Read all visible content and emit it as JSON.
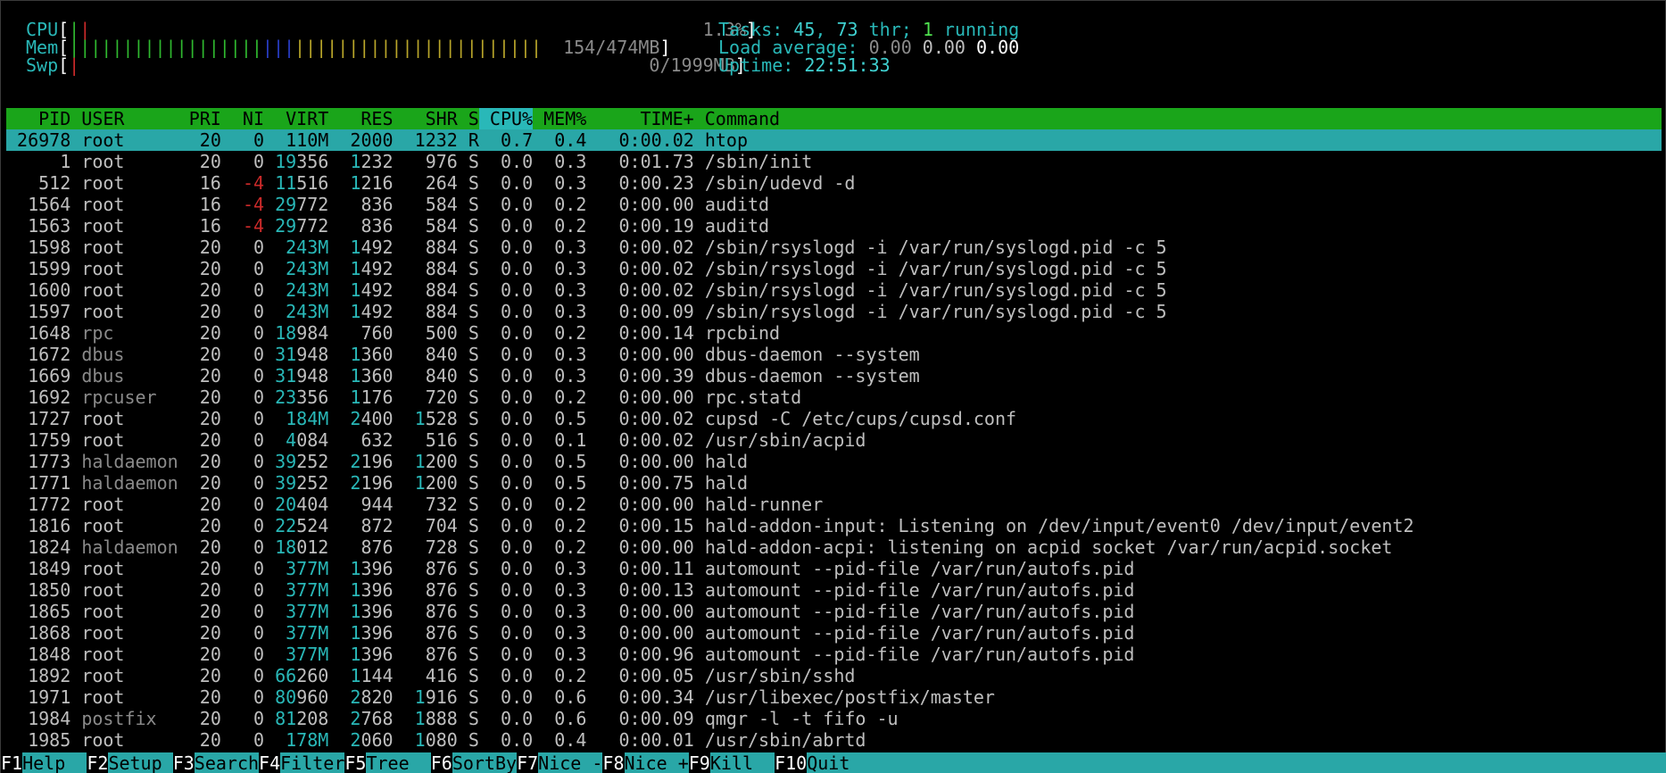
{
  "meters": {
    "cpu": {
      "label": "CPU",
      "value": "1.3%"
    },
    "mem": {
      "label": "Mem",
      "value": "154/474MB"
    },
    "swp": {
      "label": "Swp",
      "value": "0/1999MB"
    }
  },
  "stats": {
    "tasks_label": "Tasks: ",
    "tasks_count": "45",
    "thr_count": "73",
    "thr_label": " thr; ",
    "running_count": "1",
    "running_label": " running",
    "load_label": "Load average: ",
    "load1": "0.00",
    "load5": "0.00",
    "load15": "0.00",
    "uptime_label": "Uptime: ",
    "uptime": "22:51:33"
  },
  "columns": [
    "PID",
    "USER",
    "PRI",
    "NI",
    "VIRT",
    "RES",
    "SHR",
    "S",
    "CPU%",
    "MEM%",
    "TIME+",
    "Command"
  ],
  "sorted_column": "CPU%",
  "processes": [
    {
      "pid": "26978",
      "user": "root",
      "pri": "20",
      "ni": "0",
      "virt": "110M",
      "res": "2000",
      "shr": "1232",
      "s": "R",
      "cpu": "0.7",
      "mem": "0.4",
      "time": "0:00.02",
      "cmd": "htop"
    },
    {
      "pid": "1",
      "user": "root",
      "pri": "20",
      "ni": "0",
      "virt": "19356",
      "res": "1232",
      "shr": "976",
      "s": "S",
      "cpu": "0.0",
      "mem": "0.3",
      "time": "0:01.73",
      "cmd": "/sbin/init"
    },
    {
      "pid": "512",
      "user": "root",
      "pri": "16",
      "ni": "-4",
      "virt": "11516",
      "res": "1216",
      "shr": "264",
      "s": "S",
      "cpu": "0.0",
      "mem": "0.3",
      "time": "0:00.23",
      "cmd": "/sbin/udevd -d"
    },
    {
      "pid": "1564",
      "user": "root",
      "pri": "16",
      "ni": "-4",
      "virt": "29772",
      "res": "836",
      "shr": "584",
      "s": "S",
      "cpu": "0.0",
      "mem": "0.2",
      "time": "0:00.00",
      "cmd": "auditd"
    },
    {
      "pid": "1563",
      "user": "root",
      "pri": "16",
      "ni": "-4",
      "virt": "29772",
      "res": "836",
      "shr": "584",
      "s": "S",
      "cpu": "0.0",
      "mem": "0.2",
      "time": "0:00.19",
      "cmd": "auditd"
    },
    {
      "pid": "1598",
      "user": "root",
      "pri": "20",
      "ni": "0",
      "virt": "243M",
      "res": "1492",
      "shr": "884",
      "s": "S",
      "cpu": "0.0",
      "mem": "0.3",
      "time": "0:00.02",
      "cmd": "/sbin/rsyslogd -i /var/run/syslogd.pid -c 5"
    },
    {
      "pid": "1599",
      "user": "root",
      "pri": "20",
      "ni": "0",
      "virt": "243M",
      "res": "1492",
      "shr": "884",
      "s": "S",
      "cpu": "0.0",
      "mem": "0.3",
      "time": "0:00.02",
      "cmd": "/sbin/rsyslogd -i /var/run/syslogd.pid -c 5"
    },
    {
      "pid": "1600",
      "user": "root",
      "pri": "20",
      "ni": "0",
      "virt": "243M",
      "res": "1492",
      "shr": "884",
      "s": "S",
      "cpu": "0.0",
      "mem": "0.3",
      "time": "0:00.02",
      "cmd": "/sbin/rsyslogd -i /var/run/syslogd.pid -c 5"
    },
    {
      "pid": "1597",
      "user": "root",
      "pri": "20",
      "ni": "0",
      "virt": "243M",
      "res": "1492",
      "shr": "884",
      "s": "S",
      "cpu": "0.0",
      "mem": "0.3",
      "time": "0:00.09",
      "cmd": "/sbin/rsyslogd -i /var/run/syslogd.pid -c 5"
    },
    {
      "pid": "1648",
      "user": "rpc",
      "pri": "20",
      "ni": "0",
      "virt": "18984",
      "res": "760",
      "shr": "500",
      "s": "S",
      "cpu": "0.0",
      "mem": "0.2",
      "time": "0:00.14",
      "cmd": "rpcbind"
    },
    {
      "pid": "1672",
      "user": "dbus",
      "pri": "20",
      "ni": "0",
      "virt": "31948",
      "res": "1360",
      "shr": "840",
      "s": "S",
      "cpu": "0.0",
      "mem": "0.3",
      "time": "0:00.00",
      "cmd": "dbus-daemon --system"
    },
    {
      "pid": "1669",
      "user": "dbus",
      "pri": "20",
      "ni": "0",
      "virt": "31948",
      "res": "1360",
      "shr": "840",
      "s": "S",
      "cpu": "0.0",
      "mem": "0.3",
      "time": "0:00.39",
      "cmd": "dbus-daemon --system"
    },
    {
      "pid": "1692",
      "user": "rpcuser",
      "pri": "20",
      "ni": "0",
      "virt": "23356",
      "res": "1176",
      "shr": "720",
      "s": "S",
      "cpu": "0.0",
      "mem": "0.2",
      "time": "0:00.00",
      "cmd": "rpc.statd"
    },
    {
      "pid": "1727",
      "user": "root",
      "pri": "20",
      "ni": "0",
      "virt": "184M",
      "res": "2400",
      "shr": "1528",
      "s": "S",
      "cpu": "0.0",
      "mem": "0.5",
      "time": "0:00.02",
      "cmd": "cupsd -C /etc/cups/cupsd.conf"
    },
    {
      "pid": "1759",
      "user": "root",
      "pri": "20",
      "ni": "0",
      "virt": "4084",
      "res": "632",
      "shr": "516",
      "s": "S",
      "cpu": "0.0",
      "mem": "0.1",
      "time": "0:00.02",
      "cmd": "/usr/sbin/acpid"
    },
    {
      "pid": "1773",
      "user": "haldaemon",
      "pri": "20",
      "ni": "0",
      "virt": "39252",
      "res": "2196",
      "shr": "1200",
      "s": "S",
      "cpu": "0.0",
      "mem": "0.5",
      "time": "0:00.00",
      "cmd": "hald"
    },
    {
      "pid": "1771",
      "user": "haldaemon",
      "pri": "20",
      "ni": "0",
      "virt": "39252",
      "res": "2196",
      "shr": "1200",
      "s": "S",
      "cpu": "0.0",
      "mem": "0.5",
      "time": "0:00.75",
      "cmd": "hald"
    },
    {
      "pid": "1772",
      "user": "root",
      "pri": "20",
      "ni": "0",
      "virt": "20404",
      "res": "944",
      "shr": "732",
      "s": "S",
      "cpu": "0.0",
      "mem": "0.2",
      "time": "0:00.00",
      "cmd": "hald-runner"
    },
    {
      "pid": "1816",
      "user": "root",
      "pri": "20",
      "ni": "0",
      "virt": "22524",
      "res": "872",
      "shr": "704",
      "s": "S",
      "cpu": "0.0",
      "mem": "0.2",
      "time": "0:00.15",
      "cmd": "hald-addon-input: Listening on /dev/input/event0 /dev/input/event2"
    },
    {
      "pid": "1824",
      "user": "haldaemon",
      "pri": "20",
      "ni": "0",
      "virt": "18012",
      "res": "876",
      "shr": "728",
      "s": "S",
      "cpu": "0.0",
      "mem": "0.2",
      "time": "0:00.00",
      "cmd": "hald-addon-acpi: listening on acpid socket /var/run/acpid.socket"
    },
    {
      "pid": "1849",
      "user": "root",
      "pri": "20",
      "ni": "0",
      "virt": "377M",
      "res": "1396",
      "shr": "876",
      "s": "S",
      "cpu": "0.0",
      "mem": "0.3",
      "time": "0:00.11",
      "cmd": "automount --pid-file /var/run/autofs.pid"
    },
    {
      "pid": "1850",
      "user": "root",
      "pri": "20",
      "ni": "0",
      "virt": "377M",
      "res": "1396",
      "shr": "876",
      "s": "S",
      "cpu": "0.0",
      "mem": "0.3",
      "time": "0:00.13",
      "cmd": "automount --pid-file /var/run/autofs.pid"
    },
    {
      "pid": "1865",
      "user": "root",
      "pri": "20",
      "ni": "0",
      "virt": "377M",
      "res": "1396",
      "shr": "876",
      "s": "S",
      "cpu": "0.0",
      "mem": "0.3",
      "time": "0:00.00",
      "cmd": "automount --pid-file /var/run/autofs.pid"
    },
    {
      "pid": "1868",
      "user": "root",
      "pri": "20",
      "ni": "0",
      "virt": "377M",
      "res": "1396",
      "shr": "876",
      "s": "S",
      "cpu": "0.0",
      "mem": "0.3",
      "time": "0:00.00",
      "cmd": "automount --pid-file /var/run/autofs.pid"
    },
    {
      "pid": "1848",
      "user": "root",
      "pri": "20",
      "ni": "0",
      "virt": "377M",
      "res": "1396",
      "shr": "876",
      "s": "S",
      "cpu": "0.0",
      "mem": "0.3",
      "time": "0:00.96",
      "cmd": "automount --pid-file /var/run/autofs.pid"
    },
    {
      "pid": "1892",
      "user": "root",
      "pri": "20",
      "ni": "0",
      "virt": "66260",
      "res": "1144",
      "shr": "416",
      "s": "S",
      "cpu": "0.0",
      "mem": "0.2",
      "time": "0:00.05",
      "cmd": "/usr/sbin/sshd"
    },
    {
      "pid": "1971",
      "user": "root",
      "pri": "20",
      "ni": "0",
      "virt": "80960",
      "res": "2820",
      "shr": "1916",
      "s": "S",
      "cpu": "0.0",
      "mem": "0.6",
      "time": "0:00.34",
      "cmd": "/usr/libexec/postfix/master"
    },
    {
      "pid": "1984",
      "user": "postfix",
      "pri": "20",
      "ni": "0",
      "virt": "81208",
      "res": "2768",
      "shr": "1888",
      "s": "S",
      "cpu": "0.0",
      "mem": "0.6",
      "time": "0:00.09",
      "cmd": "qmgr -l -t fifo -u"
    },
    {
      "pid": "1985",
      "user": "root",
      "pri": "20",
      "ni": "0",
      "virt": "178M",
      "res": "2060",
      "shr": "1080",
      "s": "S",
      "cpu": "0.0",
      "mem": "0.4",
      "time": "0:00.01",
      "cmd": "/usr/sbin/abrtd"
    }
  ],
  "fkeys": [
    {
      "key": "F1",
      "label": "Help  "
    },
    {
      "key": "F2",
      "label": "Setup "
    },
    {
      "key": "F3",
      "label": "Search"
    },
    {
      "key": "F4",
      "label": "Filter"
    },
    {
      "key": "F5",
      "label": "Tree  "
    },
    {
      "key": "F6",
      "label": "SortBy"
    },
    {
      "key": "F7",
      "label": "Nice -"
    },
    {
      "key": "F8",
      "label": "Nice +"
    },
    {
      "key": "F9",
      "label": "Kill  "
    },
    {
      "key": "F10",
      "label": "Quit  "
    }
  ],
  "colors": {
    "cyan": "#29b8b8",
    "header_bg": "#1aa51a",
    "selected_bg": "#29a7a7",
    "red": "#cc2a2a",
    "green": "#2fb82f",
    "blue": "#2a3fcc",
    "yellow": "#b8a52a"
  }
}
